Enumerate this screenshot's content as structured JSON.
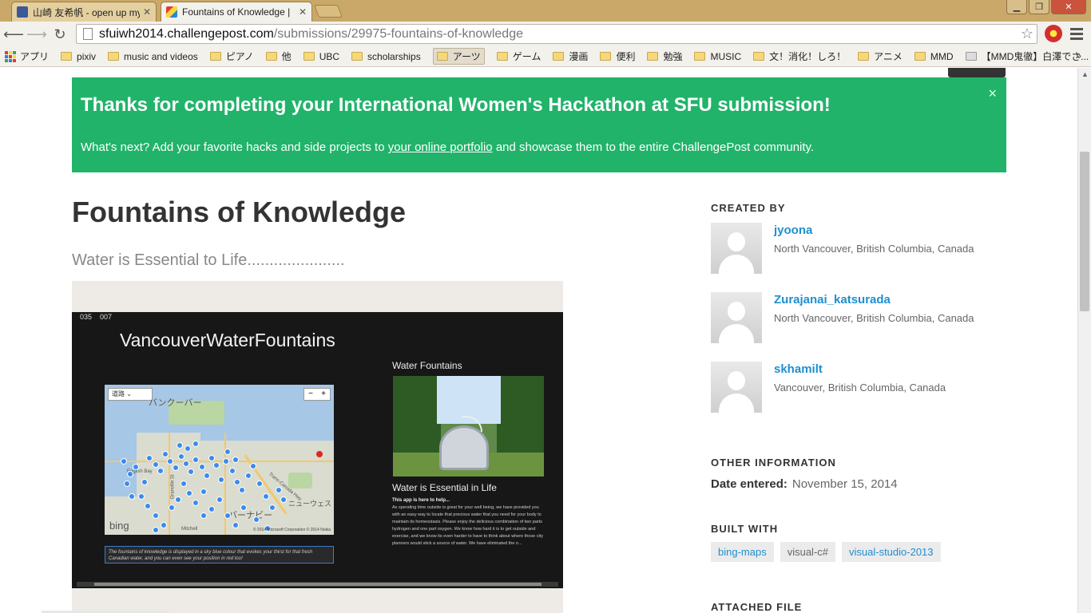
{
  "browser": {
    "tabs": [
      {
        "title": "山崎 友希帆 - open up my",
        "icon": "facebook-icon"
      },
      {
        "title": "Fountains of Knowledge |",
        "icon": "challengepost-icon"
      }
    ],
    "url_host": "sfuiwh2014.challengepost.com",
    "url_path": "/submissions/29975-fountains-of-knowledge",
    "bookmarks": [
      "アプリ",
      "pixiv",
      "music and videos",
      "ピアノ",
      "他",
      "UBC",
      "scholarships",
      "アーツ",
      "ゲーム",
      "漫画",
      "便利",
      "勉強",
      "MUSIC",
      "文！消化！しろ！",
      "アニメ",
      "MMD",
      "【MMD鬼徹】白澤でさ..."
    ],
    "bookmarks_more": "»"
  },
  "banner": {
    "heading": "Thanks for completing your International Women's Hackathon at SFU submission!",
    "text_before": "What's next? Add your favorite hacks and side projects to ",
    "link": "your online portfolio",
    "text_after": " and showcase them to the entire ChallengePost community.",
    "close": "×"
  },
  "project": {
    "title": "Fountains of Knowledge",
    "tagline": "Water is Essential to Life......................"
  },
  "screenshot": {
    "counter_a": "035",
    "counter_b": "007",
    "app_title": "VancouverWaterFountains",
    "map_mode": "道路",
    "map_bing": "bing",
    "map_copyright": "© 2014 Microsoft Corporation © 2014 Nokia",
    "map_labels": [
      "バンクーバー",
      "ニューウェス",
      "バーナビー",
      "Granville St",
      "English Bay",
      "Trans-Canada Hwy",
      "Mitchell"
    ],
    "caption": "The fountains of knowledge is displayed in a sky blue colour that evokes your thirst for that fresh Canadian water, and you can even see your position in red too!",
    "side_heading": "Water Fountains",
    "side_subheading": "Water is Essential in Life",
    "desc_head": "This app is here to help...",
    "desc": "As spending time outside is great for your well being, we have provided you with an easy way to locate that precious water that you need for your body to maintain its homeostasis. Please enjoy the delicious combination of two parts hydrogen and one part oxygen. We know how hard it is to get outside and exercise, and we know its even harder to have to think about where those city planners would stick a source of water. We have eliminated the n..."
  },
  "sidebar": {
    "created_by_heading": "CREATED BY",
    "creators": [
      {
        "name": "jyoona",
        "location": "North Vancouver, British Columbia, Canada"
      },
      {
        "name": "Zurajanai_katsurada",
        "location": "North Vancouver, British Columbia, Canada"
      },
      {
        "name": "skhamilt",
        "location": "Vancouver, British Columbia, Canada"
      }
    ],
    "other_info_heading": "OTHER INFORMATION",
    "date_label": "Date entered:",
    "date_value": "November 15, 2014",
    "built_with_heading": "BUILT WITH",
    "built_with": [
      "bing-maps",
      "visual-c#",
      "visual-studio-2013"
    ],
    "attached_heading": "ATTACHED FILE"
  },
  "colors": {
    "banner_bg": "#21b36a",
    "link": "#1f8fd0",
    "tab_strip": "#c9a86a"
  }
}
